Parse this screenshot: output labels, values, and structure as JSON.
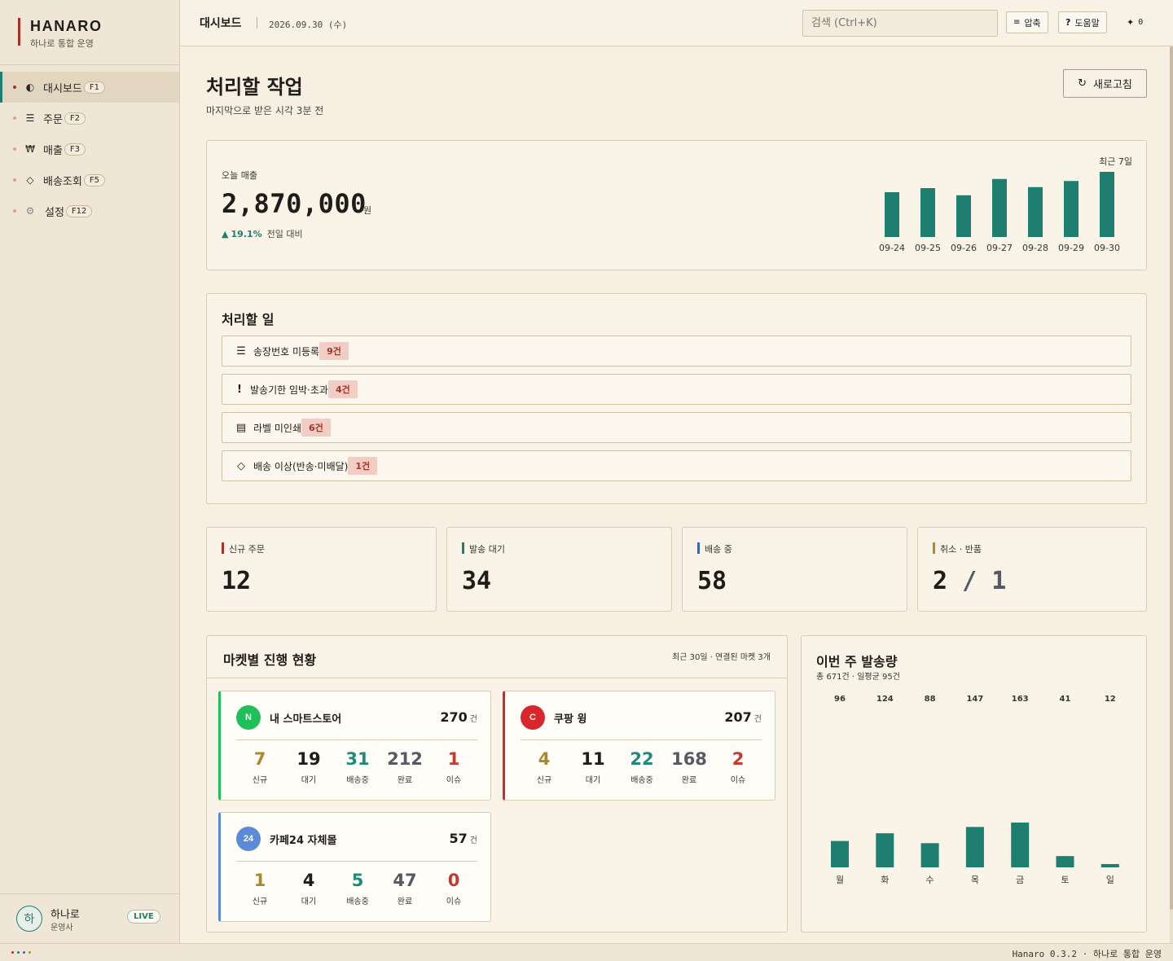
{
  "brand": {
    "name": "HANARO",
    "subtitle": "하나로 통합 운영"
  },
  "sidebar": {
    "items": [
      {
        "label": "대시보드",
        "key": "F1",
        "icon": "half-circle-icon"
      },
      {
        "label": "주문",
        "key": "F2",
        "icon": "list-icon"
      },
      {
        "label": "매출",
        "key": "F3",
        "icon": "won-icon"
      },
      {
        "label": "배송조회",
        "key": "F5",
        "icon": "diamond-icon"
      },
      {
        "label": "설정",
        "key": "F12",
        "icon": "gear-icon"
      }
    ],
    "user": {
      "avatar": "하",
      "name": "하나로",
      "role": "운영사",
      "status": "LIVE"
    }
  },
  "topbar": {
    "title": "대시보드",
    "date": "2026.09.30 (수)",
    "search_placeholder": "검색 (Ctrl+K)",
    "compact_label": "압축",
    "help_label": "도움말",
    "notif_count": "0"
  },
  "page": {
    "title": "처리할 작업",
    "subtitle": "마지막으로 받은 시각 3분 전",
    "refresh_label": "새로고침"
  },
  "sales": {
    "label": "오늘 매출",
    "value": "2,870,000",
    "unit": "원",
    "delta": "19.1%",
    "delta_label": "전일 대비",
    "range_label": "최근 7일"
  },
  "todo": {
    "title": "처리할 일",
    "items": [
      {
        "icon": "list-icon",
        "label": "송장번호 미등록",
        "count": "9건"
      },
      {
        "icon": "exclamation-icon",
        "label": "발송기한 임박·초과",
        "count": "4건"
      },
      {
        "icon": "label-icon",
        "label": "라벨 미인쇄",
        "count": "6건"
      },
      {
        "icon": "diamond-icon",
        "label": "배송 이상(반송·미배달)",
        "count": "1건"
      }
    ]
  },
  "stats": [
    {
      "label": "신규 주문",
      "value": "12",
      "color": "#a8322b"
    },
    {
      "label": "발송 대기",
      "value": "34",
      "color": "#1e7f70"
    },
    {
      "label": "배송 중",
      "value": "58",
      "color": "#3d64b4"
    },
    {
      "label": "취소 · 반품",
      "value_a": "2",
      "slash": "/",
      "value_b": "1",
      "color": "#b8862a"
    }
  ],
  "markets": {
    "title": "마켓별 진행 현황",
    "meta": "최근 30일 · 연결된 마켓 3개",
    "cards": [
      {
        "logo": "N",
        "name": "내 스마트스토어",
        "total": "270",
        "unit": "건",
        "color": "#1fc05a",
        "stats": [
          {
            "v": "7",
            "l": "신규"
          },
          {
            "v": "19",
            "l": "대기"
          },
          {
            "v": "31",
            "l": "배송중"
          },
          {
            "v": "212",
            "l": "완료"
          },
          {
            "v": "1",
            "l": "이슈"
          }
        ]
      },
      {
        "logo": "C",
        "name": "쿠팡 윙",
        "total": "207",
        "unit": "건",
        "color": "#d8262c",
        "stats": [
          {
            "v": "4",
            "l": "신규"
          },
          {
            "v": "11",
            "l": "대기"
          },
          {
            "v": "22",
            "l": "배송중"
          },
          {
            "v": "168",
            "l": "완료"
          },
          {
            "v": "2",
            "l": "이슈"
          }
        ]
      },
      {
        "logo": "24",
        "name": "카페24 자체몰",
        "total": "57",
        "unit": "건",
        "color": "#5b8ad6",
        "stats": [
          {
            "v": "1",
            "l": "신규"
          },
          {
            "v": "4",
            "l": "대기"
          },
          {
            "v": "5",
            "l": "배송중"
          },
          {
            "v": "47",
            "l": "완료"
          },
          {
            "v": "0",
            "l": "이슈"
          }
        ]
      }
    ],
    "stat_colors": [
      "#a88a2c",
      "#1f1d1a",
      "#1e8a78",
      "#555a63",
      "#c33a32"
    ]
  },
  "weekly": {
    "title": "이번 주 발송량",
    "subtitle": "총 671건 · 일평균 95건"
  },
  "chart_data": [
    {
      "type": "bar",
      "categories": [
        "09-24",
        "09-25",
        "09-26",
        "09-27",
        "09-28",
        "09-29",
        "09-30"
      ],
      "values": [
        2.2,
        2.4,
        2.05,
        2.85,
        2.45,
        2.75,
        3.2
      ],
      "title": "최근 7일",
      "color": "#1e7f70"
    },
    {
      "type": "bar",
      "categories": [
        "월",
        "화",
        "수",
        "목",
        "금",
        "토",
        "일"
      ],
      "values": [
        96,
        124,
        88,
        147,
        163,
        41,
        12
      ],
      "title": "",
      "color": "#1e7f70"
    }
  ],
  "statusbar": {
    "text": "Hanaro 0.3.2 · 하나로 통합 운영",
    "dot_colors": [
      "#a8322b",
      "#1e7f70",
      "#3d64b4",
      "#b8862a"
    ]
  }
}
